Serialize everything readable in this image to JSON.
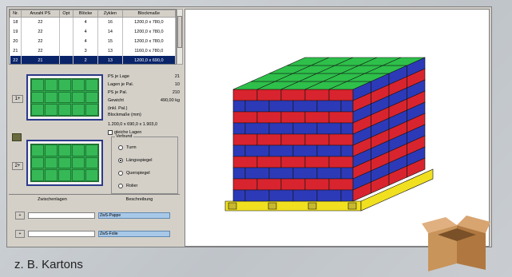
{
  "table": {
    "headers": [
      "Nr.",
      "Anzahl PS",
      "Opt",
      "Blöcke",
      "Zyklen",
      "Blockmaße"
    ],
    "rows": [
      [
        "18",
        "22",
        "",
        "4",
        "16",
        "1200,0 x 780,0"
      ],
      [
        "19",
        "22",
        "",
        "4",
        "14",
        "1200,0 x 780,0"
      ],
      [
        "20",
        "22",
        "",
        "4",
        "15",
        "1200,0 x 780,0"
      ],
      [
        "21",
        "22",
        "",
        "3",
        "13",
        "1160,0 x 780,0"
      ],
      [
        "22",
        "21",
        "",
        "2",
        "13",
        "1200,0 x 690,0"
      ]
    ],
    "selected_index": 4
  },
  "buttons": {
    "layer1": "1+",
    "layer2": "2+",
    "add": "+"
  },
  "info": {
    "ps_je_lage_label": "PS je Lage",
    "ps_je_lage_value": "21",
    "lagen_je_pal_label": "Lagen je Pal.",
    "lagen_je_pal_value": "10",
    "ps_je_pal_label": "PS je Pal.",
    "ps_je_pal_value": "210",
    "gewicht_label": "Gewicht",
    "gewicht_value": "490,00",
    "gewicht_unit": "kg",
    "gewicht_sub": "(inkl. Pal.)",
    "blockmasse_label": "Blockmaße (mm)",
    "blockmasse_value": "1.200,0 x 690,0 x 1.903,0"
  },
  "checkbox_label": "gleiche Lagen",
  "verbund": {
    "legend": "Verbund",
    "options": [
      "Turm",
      "Längsspiegel",
      "Querspiegel",
      "Rolier"
    ],
    "selected": 1
  },
  "section": {
    "left": "Zwischenlagen",
    "right": "Beschreibung"
  },
  "zwischenlagen": [
    {
      "label": "ZwS-Pappe"
    },
    {
      "label": "ZwS-Folie"
    }
  ],
  "caption": "z. B. Kartons",
  "colors": {
    "top": "#2ec04a",
    "blue": "#2c3ab8",
    "red": "#d8242e",
    "pallet": "#f0e020"
  },
  "pallet_stack": {
    "layers": 10
  }
}
